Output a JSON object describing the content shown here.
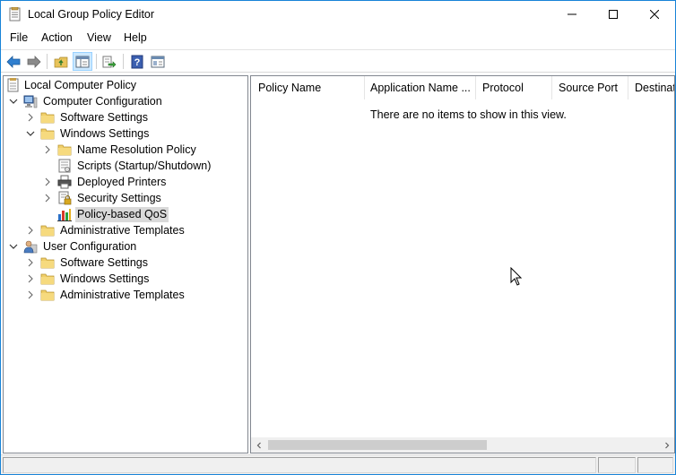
{
  "window": {
    "title": "Local Group Policy Editor"
  },
  "menu": [
    "File",
    "Action",
    "View",
    "Help"
  ],
  "toolbar": [
    "back-icon",
    "forward-icon",
    "up-folder-icon",
    "show-hide-tree-icon",
    "export-list-icon",
    "help-icon",
    "properties-icon"
  ],
  "tree": [
    {
      "label": "Local Computer Policy",
      "icon": "policy-doc-icon"
    },
    {
      "label": "Computer Configuration",
      "icon": "computer-icon"
    },
    {
      "label": "Software Settings",
      "icon": "folder-icon"
    },
    {
      "label": "Windows Settings",
      "icon": "folder-icon"
    },
    {
      "label": "Name Resolution Policy",
      "icon": "folder-icon"
    },
    {
      "label": "Scripts (Startup/Shutdown)",
      "icon": "scripts-icon"
    },
    {
      "label": "Deployed Printers",
      "icon": "printer-icon"
    },
    {
      "label": "Security Settings",
      "icon": "security-icon"
    },
    {
      "label": "Policy-based QoS",
      "icon": "qos-chart-icon",
      "selected": true
    },
    {
      "label": "Administrative Templates",
      "icon": "folder-icon"
    },
    {
      "label": "User Configuration",
      "icon": "user-icon"
    },
    {
      "label": "Software Settings",
      "icon": "folder-icon"
    },
    {
      "label": "Windows Settings",
      "icon": "folder-icon"
    },
    {
      "label": "Administrative Templates",
      "icon": "folder-icon"
    }
  ],
  "list": {
    "columns": [
      "Policy Name",
      "Application Name ...",
      "Protocol",
      "Source Port",
      "Destinat"
    ],
    "empty_message": "There are no items to show in this view."
  }
}
